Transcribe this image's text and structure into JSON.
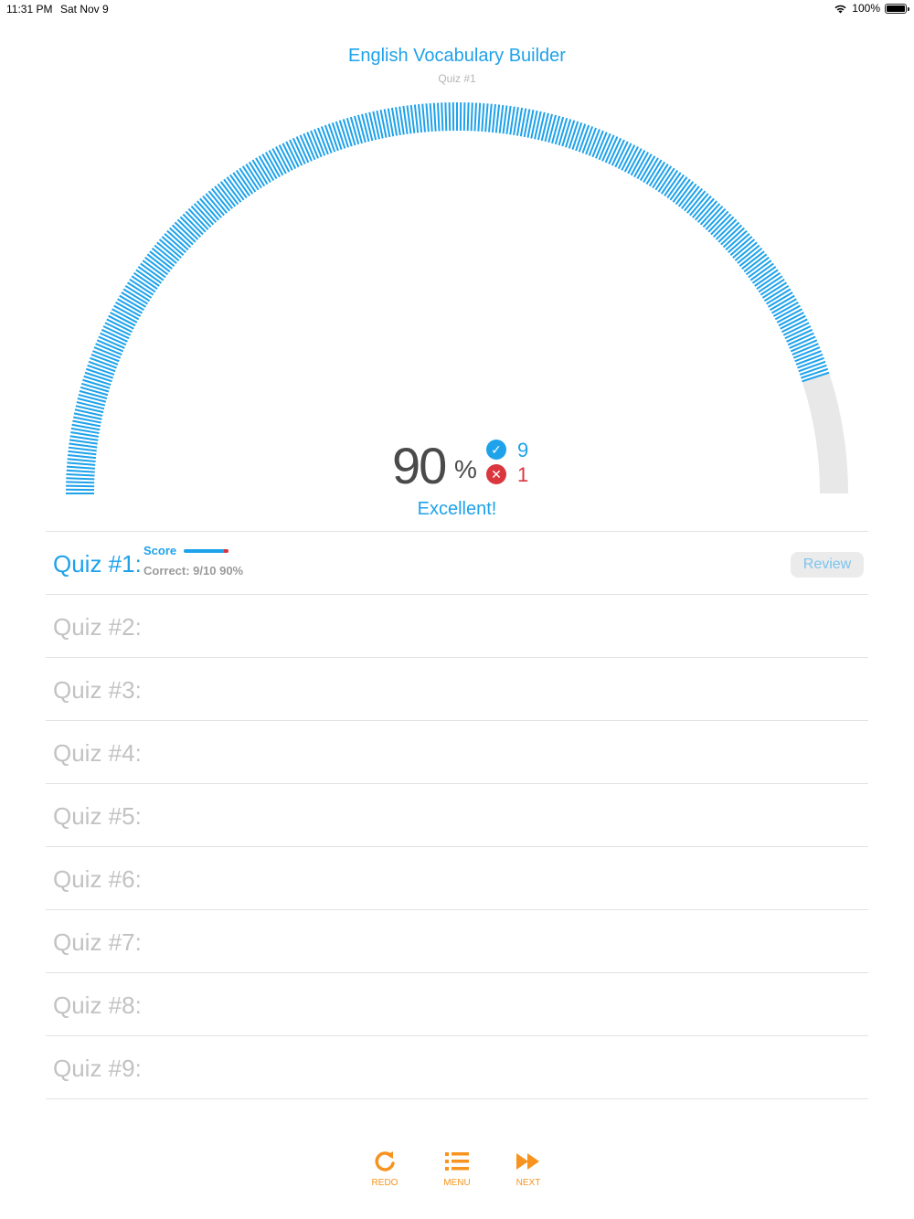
{
  "status_bar": {
    "time": "11:31 PM",
    "date": "Sat Nov 9",
    "battery": "100%"
  },
  "header": {
    "title": "English Vocabulary Builder",
    "subtitle": "Quiz #1"
  },
  "gauge": {
    "progress_fraction": 0.9,
    "fill_color": "#1ea2ea",
    "track_color": "#e8e8e8"
  },
  "summary": {
    "percent": "90",
    "percent_sign": "%",
    "correct": "9",
    "wrong": "1",
    "rating": "Excellent!"
  },
  "colors": {
    "accent": "#1ea2ea",
    "wrong": "#d9363e",
    "toolbar": "#f7931e",
    "inactive": "#c2c2c2"
  },
  "quizzes": [
    {
      "label": "Quiz #1:",
      "score_label": "Score",
      "score_fraction": 0.9,
      "correct_text": "Correct: 9/10  90%",
      "review_label": "Review"
    },
    {
      "label": "Quiz #2:"
    },
    {
      "label": "Quiz #3:"
    },
    {
      "label": "Quiz #4:"
    },
    {
      "label": "Quiz #5:"
    },
    {
      "label": "Quiz #6:"
    },
    {
      "label": "Quiz #7:"
    },
    {
      "label": "Quiz #8:"
    },
    {
      "label": "Quiz #9:"
    }
  ],
  "toolbar": {
    "redo": {
      "label": "REDO",
      "icon": "redo-icon"
    },
    "menu": {
      "label": "MENU",
      "icon": "list-icon"
    },
    "next": {
      "label": "NEXT",
      "icon": "fast-forward-icon"
    }
  }
}
